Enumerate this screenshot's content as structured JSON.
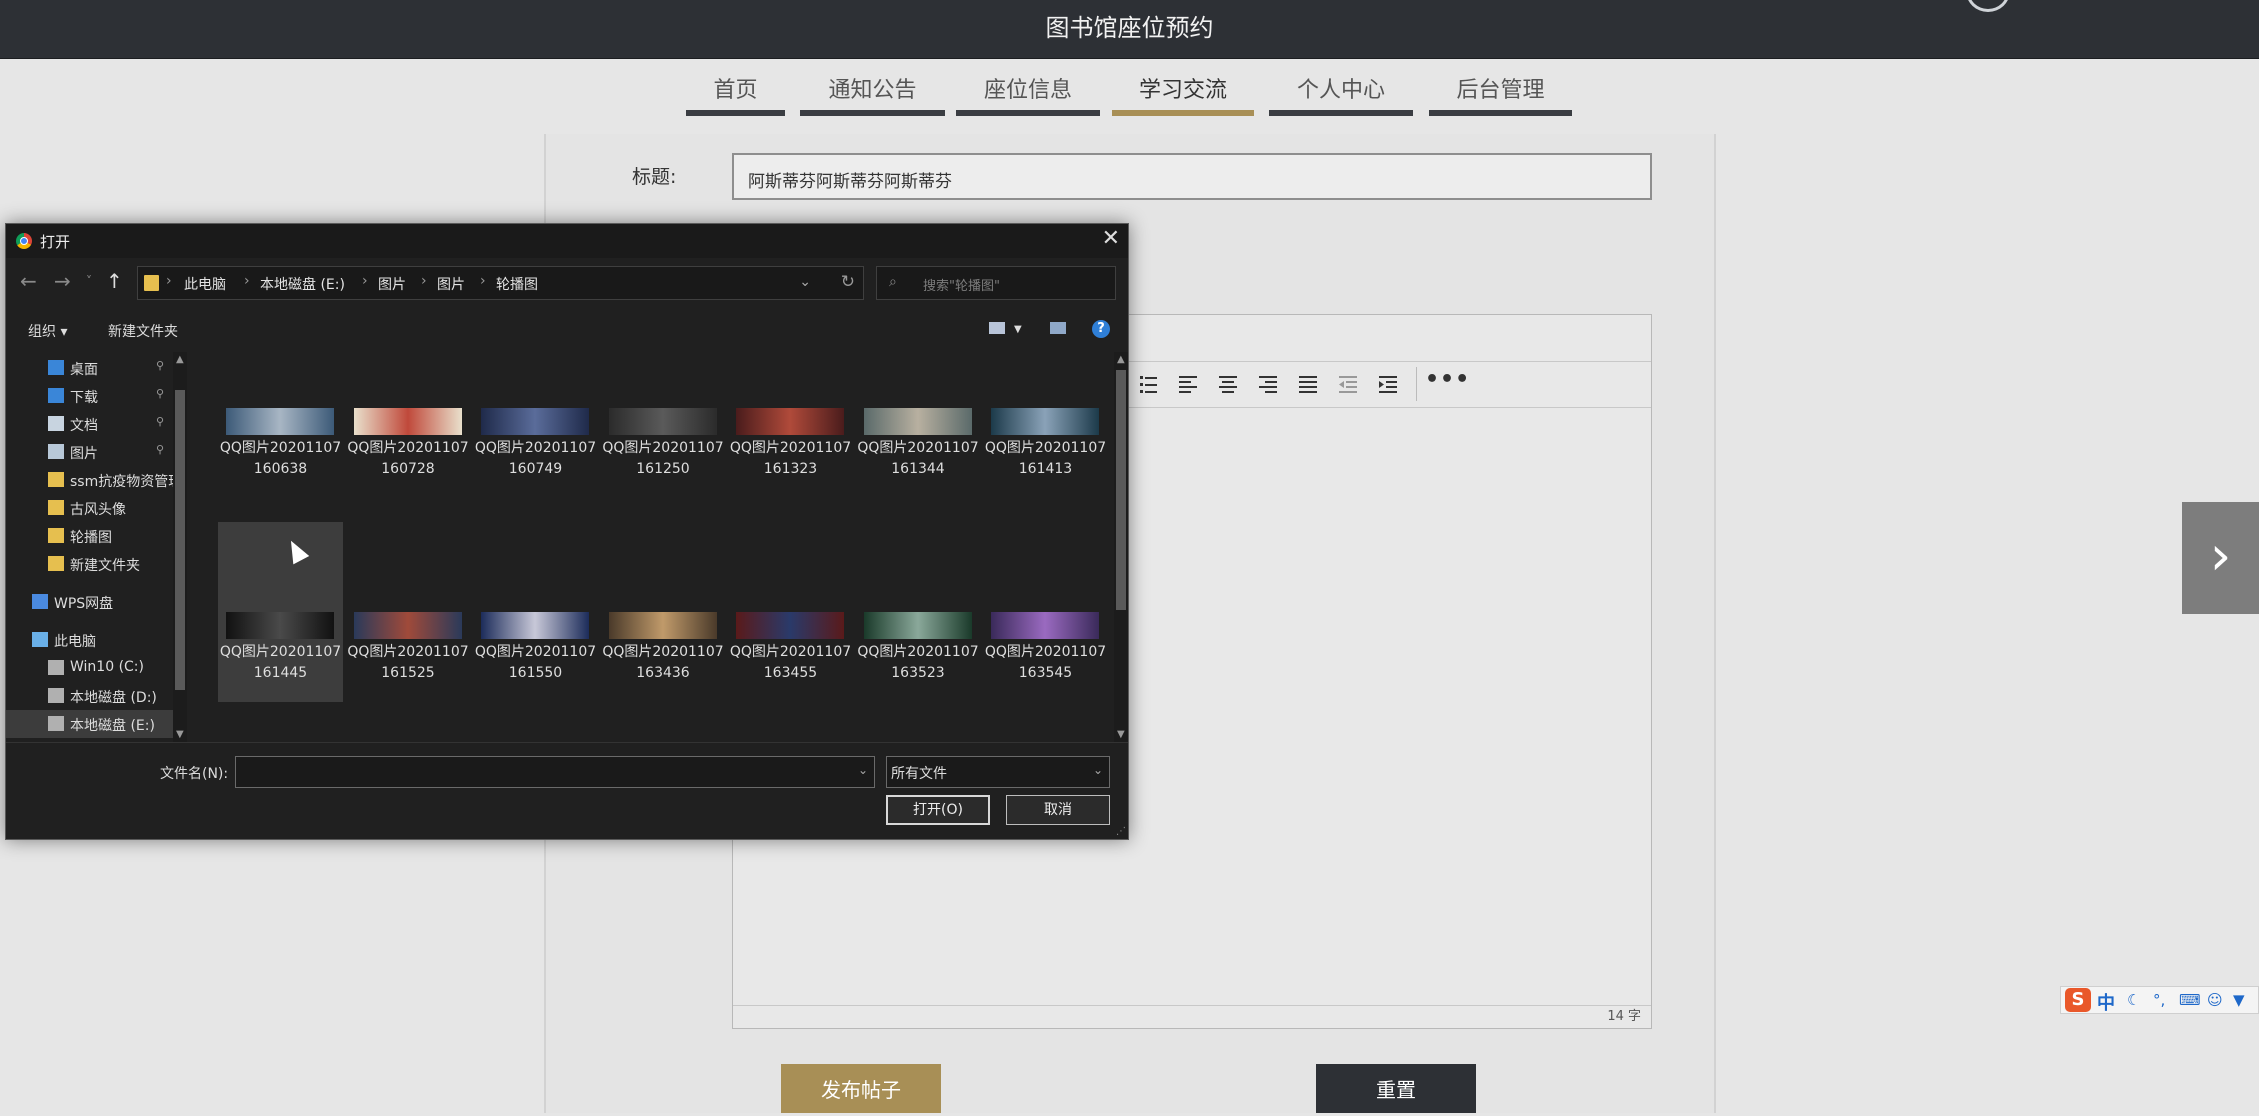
{
  "header": {
    "site_title": "图书馆座位预约"
  },
  "nav": {
    "tabs": [
      {
        "label": "首页",
        "active": false
      },
      {
        "label": "通知公告",
        "active": false
      },
      {
        "label": "座位信息",
        "active": false
      },
      {
        "label": "学习交流",
        "active": true
      },
      {
        "label": "个人中心",
        "active": false
      },
      {
        "label": "后台管理",
        "active": false
      }
    ]
  },
  "form": {
    "title_label": "标题:",
    "title_value": "阿斯蒂芬阿斯蒂芬阿斯蒂芬",
    "word_count": "14 字",
    "toolbar_icons": [
      "list-icon",
      "align-left-icon",
      "align-center-icon",
      "align-right-icon",
      "align-justify-icon",
      "outdent-icon",
      "indent-icon"
    ],
    "more_label": "•••",
    "publish_button": "发布帖子",
    "reset_button": "重置"
  },
  "carousel": {
    "next_label": "›"
  },
  "ime": {
    "logo": "S",
    "mode": "中"
  },
  "dialog": {
    "title": "打开",
    "close": "✕",
    "breadcrumb": [
      "此电脑",
      "本地磁盘 (E:)",
      "图片",
      "图片",
      "轮播图"
    ],
    "search_placeholder": "搜索\"轮播图\"",
    "organize": "组织 ▾",
    "new_folder": "新建文件夹",
    "help": "?",
    "nav_items": [
      {
        "label": "桌面",
        "icon": "desktop-icon",
        "pinned": true
      },
      {
        "label": "下载",
        "icon": "download-icon",
        "pinned": true
      },
      {
        "label": "文档",
        "icon": "document-icon",
        "pinned": true
      },
      {
        "label": "图片",
        "icon": "pictures-icon",
        "pinned": true
      },
      {
        "label": "ssm抗疫物资管理",
        "icon": "folder-icon",
        "pinned": false
      },
      {
        "label": "古风头像",
        "icon": "folder-icon",
        "pinned": false
      },
      {
        "label": "轮播图",
        "icon": "folder-icon",
        "pinned": false
      },
      {
        "label": "新建文件夹",
        "icon": "folder-icon",
        "pinned": false
      },
      {
        "label": "WPS网盘",
        "icon": "cloud-icon",
        "pinned": false
      },
      {
        "label": "此电脑",
        "icon": "computer-icon",
        "pinned": false
      },
      {
        "label": "Win10 (C:)",
        "icon": "drive-icon",
        "pinned": false
      },
      {
        "label": "本地磁盘 (D:)",
        "icon": "drive-icon",
        "pinned": false
      },
      {
        "label": "本地磁盘 (E:)",
        "icon": "drive-icon",
        "pinned": false,
        "selected": true
      }
    ],
    "files": [
      {
        "name": "QQ图片20201107160638",
        "colors": [
          "#3c5a78",
          "#a8b6c4"
        ]
      },
      {
        "name": "QQ图片20201107160728",
        "colors": [
          "#e9e0cc",
          "#c0493b"
        ]
      },
      {
        "name": "QQ图片20201107160749",
        "colors": [
          "#1f2a4a",
          "#5a6c9a"
        ]
      },
      {
        "name": "QQ图片20201107161250",
        "colors": [
          "#2b2b2b",
          "#5a5a5a"
        ]
      },
      {
        "name": "QQ图片20201107161323",
        "colors": [
          "#4a1c1c",
          "#b04a3a"
        ]
      },
      {
        "name": "QQ图片20201107161344",
        "colors": [
          "#5a6a6a",
          "#b8b0a0"
        ]
      },
      {
        "name": "QQ图片20201107161413",
        "colors": [
          "#1c3a4a",
          "#8aa2b8"
        ]
      },
      {
        "name": "QQ图片20201107161445",
        "colors": [
          "#111111",
          "#4a4a4a"
        ],
        "selected": true
      },
      {
        "name": "QQ图片20201107161525",
        "colors": [
          "#2a3a5a",
          "#a04a3a"
        ]
      },
      {
        "name": "QQ图片20201107161550",
        "colors": [
          "#1c2c5a",
          "#c8c8d8"
        ]
      },
      {
        "name": "QQ图片20201107163436",
        "colors": [
          "#4a3a2a",
          "#c09a6a"
        ]
      },
      {
        "name": "QQ图片20201107163455",
        "colors": [
          "#5a1a1a",
          "#2a3a6a"
        ]
      },
      {
        "name": "QQ图片20201107163523",
        "colors": [
          "#1a3a2a",
          "#8aa89a"
        ]
      },
      {
        "name": "QQ图片20201107163545",
        "colors": [
          "#3a2a5a",
          "#9a6ac0"
        ]
      }
    ],
    "filename_label": "文件名(N):",
    "filename_value": "",
    "filter_value": "所有文件",
    "open_button": "打开(O)",
    "cancel_button": "取消"
  }
}
